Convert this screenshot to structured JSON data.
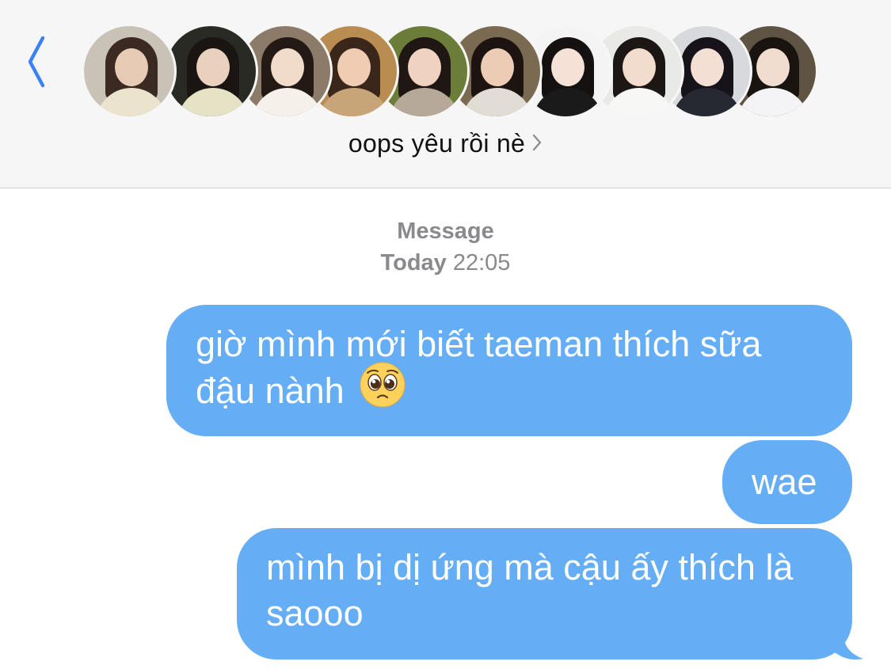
{
  "header": {
    "back_icon": "chevron-left-icon",
    "accent_color": "#3b82f6",
    "group_name": "oops yêu rồi nè",
    "group_chevron_icon": "chevron-right-icon",
    "avatars": [
      {
        "name": "avatar-1"
      },
      {
        "name": "avatar-2"
      },
      {
        "name": "avatar-3"
      },
      {
        "name": "avatar-4"
      },
      {
        "name": "avatar-5"
      },
      {
        "name": "avatar-6"
      },
      {
        "name": "avatar-7"
      },
      {
        "name": "avatar-8"
      },
      {
        "name": "avatar-9"
      },
      {
        "name": "avatar-10"
      }
    ]
  },
  "conversation": {
    "service_label": "Message",
    "day_label": "Today",
    "time": "22:05",
    "bubble_color": "#65aef5",
    "messages": [
      {
        "text": "giờ mình mới biết taeman thích sữa đậu nành",
        "emoji": "pleading-face-emoji"
      },
      {
        "text": "wae"
      },
      {
        "text": "mình bị dị ứng mà cậu ấy thích là saooo"
      }
    ]
  }
}
